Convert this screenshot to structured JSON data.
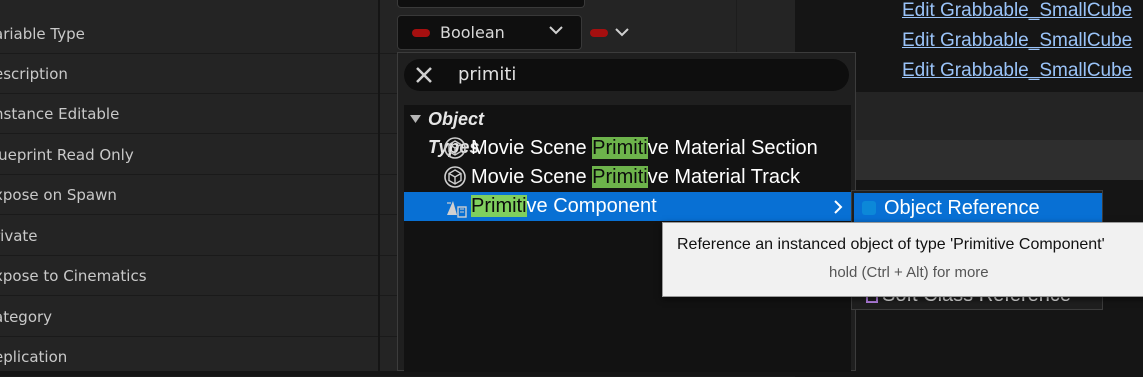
{
  "details": {
    "rows": [
      {
        "label": "ariable Type"
      },
      {
        "label": "escription"
      },
      {
        "label": "nstance Editable"
      },
      {
        "label": "lueprint Read Only"
      },
      {
        "label": "xpose on Spawn"
      },
      {
        "label": "rivate"
      },
      {
        "label": "xpose to Cinematics"
      },
      {
        "label": "ategory"
      },
      {
        "label": "eplication"
      }
    ],
    "variable_type": {
      "value": "Boolean",
      "pin_color": "#a50f0f"
    }
  },
  "right_panel": {
    "links": [
      "Edit Grabbable_SmallCube",
      "Edit Grabbable_SmallCube",
      "Edit Grabbable_SmallCube"
    ]
  },
  "type_menu": {
    "search": {
      "value": "primiti"
    },
    "category": {
      "label": "Object Types"
    },
    "items": [
      {
        "pre": "Movie Scene ",
        "match": "Primiti",
        "post": "ve Material Section",
        "icon": "struct-icon",
        "selected": false
      },
      {
        "pre": "Movie Scene ",
        "match": "Primiti",
        "post": "ve Material Track",
        "icon": "struct-icon",
        "selected": false
      },
      {
        "pre": "",
        "match": "Primiti",
        "post": "ve Component",
        "icon": "component-icon",
        "selected": true
      }
    ],
    "highlight_color": "#6db34b",
    "selection_color": "#0870d4"
  },
  "submenu": {
    "items": [
      "Object Reference",
      "Soft Class Reference"
    ]
  },
  "tooltip": {
    "text": "Reference an instanced object of type 'Primitive Component'",
    "hint": "hold (Ctrl + Alt) for more"
  }
}
